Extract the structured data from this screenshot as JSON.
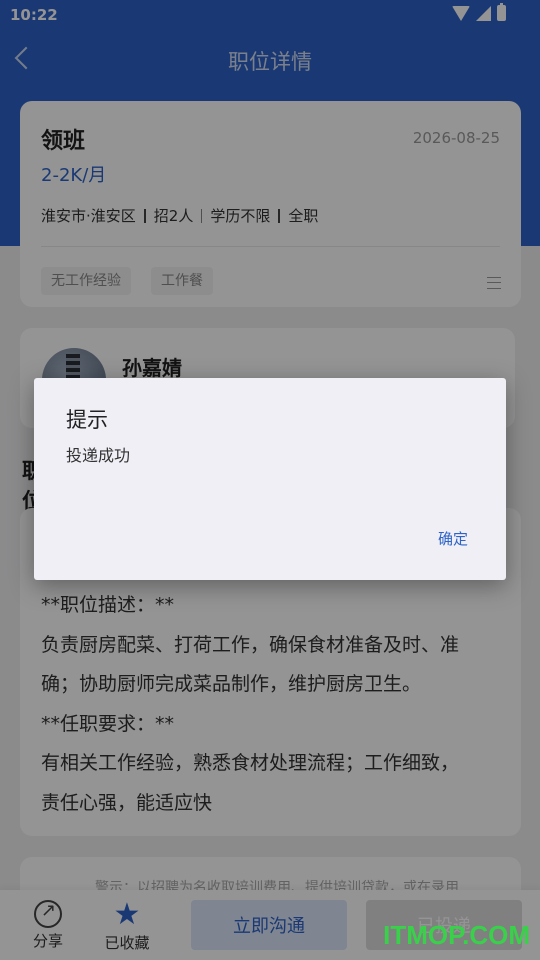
{
  "status_bar": {
    "time": "10:22"
  },
  "nav": {
    "title": "职位详情"
  },
  "job": {
    "title": "领班",
    "date": "2026-08-25",
    "salary": "2-2K/月",
    "location": "淮安市·淮安区",
    "headcount": "招2人",
    "education": "学历不限",
    "type": "全职",
    "benefits": [
      "无工作经验",
      "工作餐"
    ]
  },
  "recruiter": {
    "name": "孙嘉婧"
  },
  "description": {
    "heading": "职位描述",
    "lines": [
      "**职位描述：**",
      "负责厨房配菜、打荷工作，确保食材准备及时、准",
      "确；协助厨师完成菜品制作，维护厨房卫生。",
      "**任职要求：**",
      "有相关工作经验，熟悉食材处理流程；工作细致，",
      "责任心强，能适应快"
    ]
  },
  "warning": {
    "text": "警示：以招聘为名收取培训费用、提供培训贷款，或在录用"
  },
  "bottom_bar": {
    "share_label": "分享",
    "favorite_label": "已收藏",
    "chat_label": "立即沟通",
    "apply_label": "已投递"
  },
  "dialog": {
    "title": "提示",
    "message": "投递成功",
    "confirm_label": "确定"
  },
  "watermark": "ITMOP.COM",
  "colors": {
    "primary": "#2e63c9",
    "watermark": "#39d04a"
  }
}
